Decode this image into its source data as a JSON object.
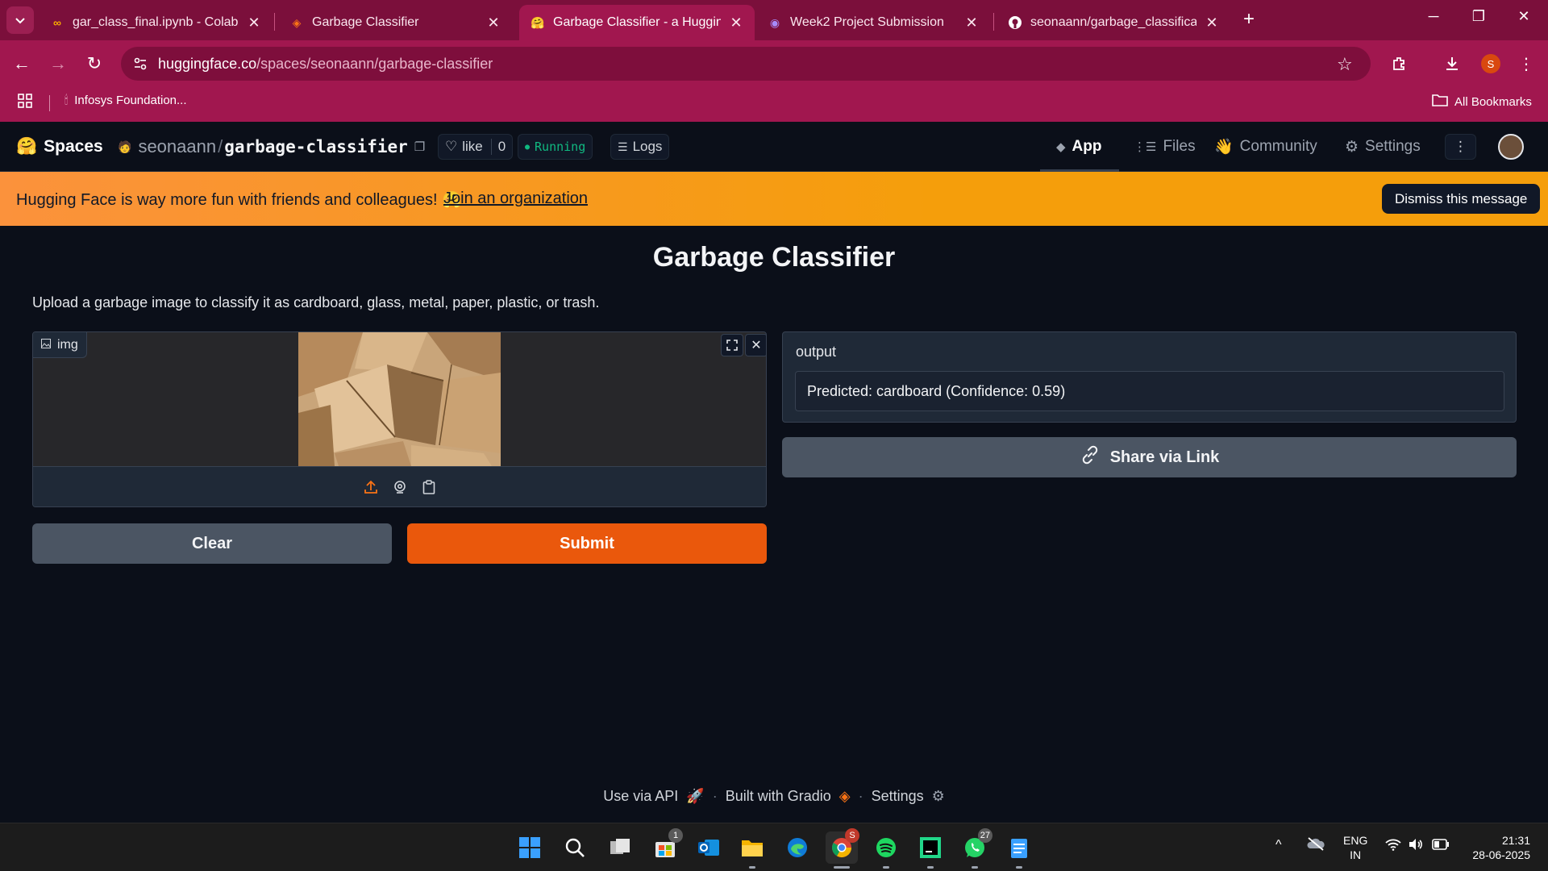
{
  "browser": {
    "tabs": [
      {
        "title": "gar_class_final.ipynb - Colab",
        "icon": "colab-icon"
      },
      {
        "title": "Garbage Classifier",
        "icon": "gradio-icon"
      },
      {
        "title": "Garbage Classifier - a Hugging Face Space",
        "icon": "huggingface-icon",
        "active": true
      },
      {
        "title": "Week2 Project Submission",
        "icon": "forms-icon"
      },
      {
        "title": "seonaann/garbage_classification",
        "icon": "github-icon"
      }
    ],
    "url_host": "huggingface.co",
    "url_path": "/spaces/seonaann/garbage-classifier",
    "profile_initial": "S",
    "bookmarks": {
      "item": "Infosys Foundation...",
      "all": "All Bookmarks"
    }
  },
  "hf": {
    "brand": "Spaces",
    "owner": "seonaann",
    "slash": "/",
    "repo": "garbage-classifier",
    "like_label": "like",
    "like_count": "0",
    "status": "Running",
    "logs": "Logs",
    "nav": {
      "app": "App",
      "files": "Files",
      "community": "Community",
      "settings": "Settings"
    }
  },
  "banner": {
    "message": "Hugging Face is way more fun with friends and colleagues! 🤗",
    "link": "Join an organization",
    "dismiss": "Dismiss this message"
  },
  "app": {
    "title": "Garbage Classifier",
    "description": "Upload a garbage image to classify it as cardboard, glass, metal, paper, plastic, or trash.",
    "image_label": "img",
    "output_label": "output",
    "output_value": "Predicted: cardboard (Confidence: 0.59)",
    "share": "Share via Link",
    "clear": "Clear",
    "submit": "Submit"
  },
  "footer": {
    "api": "Use via API",
    "gradio": "Built with Gradio",
    "settings": "Settings",
    "sep": "·"
  },
  "taskbar": {
    "outlook_badge": "1",
    "chrome_badge": "S",
    "whatsapp_badge": "27",
    "lang": "ENG",
    "region": "IN",
    "time": "21:31",
    "date": "28-06-2025"
  },
  "colors": {
    "chrome": "#a1174f",
    "banner": "#f59e0b",
    "submit": "#ea580c",
    "running": "#10b981"
  }
}
